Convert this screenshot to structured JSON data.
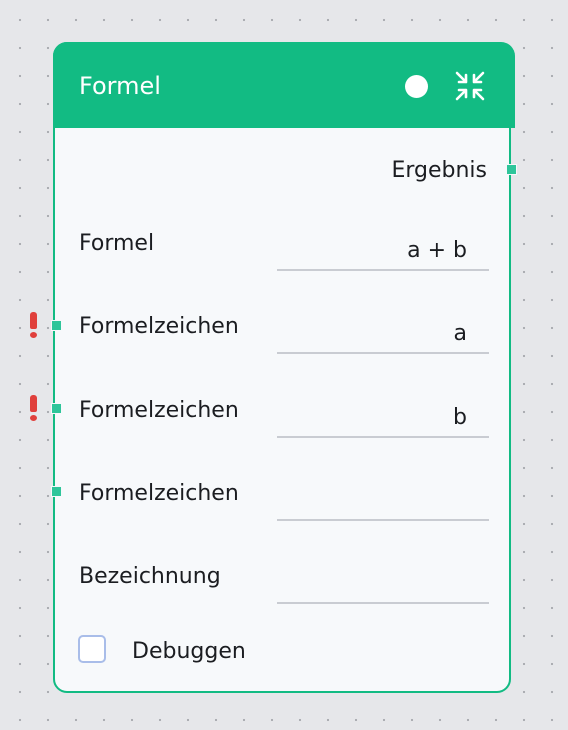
{
  "node": {
    "title": "Formel",
    "output_label": "Ergebnis",
    "colors": {
      "accent": "#12bb83",
      "port": "#2fc59a",
      "warning": "#e0403c",
      "checkbox_border": "#a9bde9"
    },
    "header_icons": [
      "status-dot-icon",
      "collapse-icon"
    ],
    "rows": [
      {
        "label": "Formel",
        "value": "a + b"
      },
      {
        "label": "Formelzeichen",
        "value": "a",
        "warning": "!"
      },
      {
        "label": "Formelzeichen",
        "value": "b",
        "warning": "!"
      },
      {
        "label": "Formelzeichen",
        "value": ""
      },
      {
        "label": "Bezeichnung",
        "value": ""
      }
    ],
    "debug": {
      "label": "Debuggen",
      "checked": false
    }
  }
}
